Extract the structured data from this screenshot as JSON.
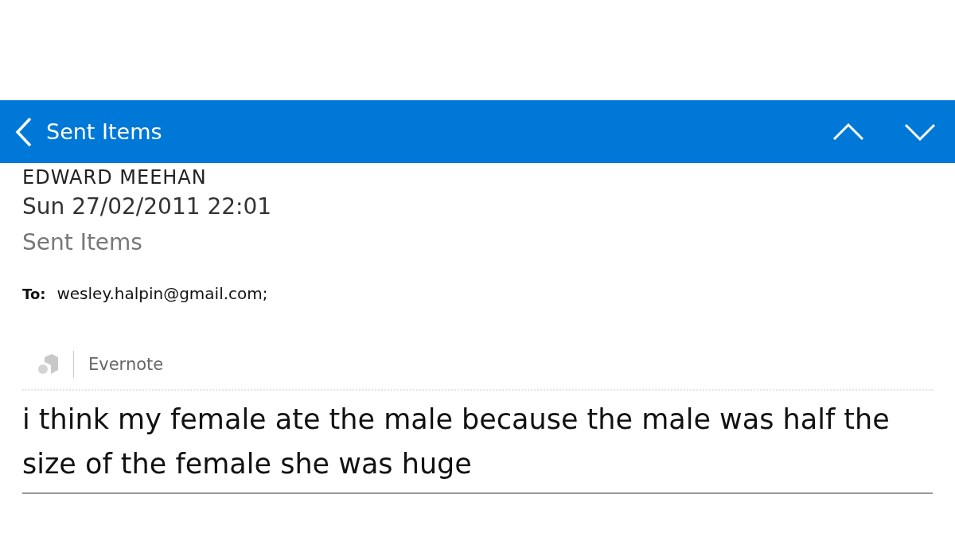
{
  "header": {
    "back_label": "Sent Items"
  },
  "message": {
    "sender": "EDWARD MEEHAN",
    "date": "Sun 27/02/2011 22:01",
    "folder": "Sent Items",
    "to_label": "To:",
    "to": "wesley.halpin@gmail.com;"
  },
  "addin": {
    "name": "Evernote"
  },
  "body": "i think my female ate the male because the male was half the size of the female she was huge"
}
